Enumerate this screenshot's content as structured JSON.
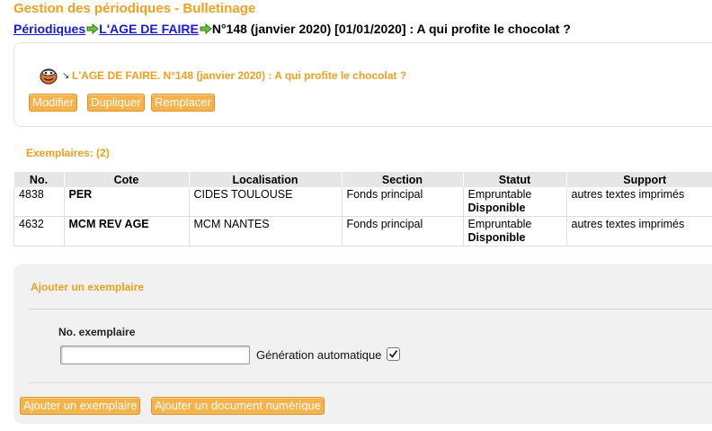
{
  "page": {
    "title": "Gestion des périodiques - Bulletinage"
  },
  "breadcrumb": {
    "items": [
      "Périodiques",
      "L'AGE DE FAIRE"
    ],
    "current": "N°148 (janvier 2020) [01/01/2020] : A qui profite le chocolat ?"
  },
  "record": {
    "title": "L'AGE DE FAIRE. N°148 (janvier 2020) : A qui profite le chocolat ?",
    "link_icon": "↘",
    "buttons": {
      "modify": "Modifier",
      "duplicate": "Dupliquer",
      "replace": "Remplacer"
    }
  },
  "copies": {
    "label": "Exemplaires: (2)",
    "columns": [
      "No.",
      "Cote",
      "Localisation",
      "Section",
      "Statut",
      "Support"
    ],
    "rows": [
      {
        "no": "4838",
        "cote": "PER",
        "localisation": "CIDES TOULOUSE",
        "section": "Fonds principal",
        "statut": "Empruntable",
        "statut2": "Disponible",
        "support": "autres textes imprimés"
      },
      {
        "no": "4632",
        "cote": "MCM REV AGE",
        "localisation": "MCM NANTES",
        "section": "Fonds principal",
        "statut": "Empruntable",
        "statut2": "Disponible",
        "support": "autres textes imprimés"
      }
    ]
  },
  "add": {
    "title": "Ajouter un exemplaire",
    "field_label": "No. exemplaire",
    "field_value": "",
    "auto_label": "Génération automatique",
    "auto_checked": true,
    "buttons": {
      "add_copy": "Ajouter un exemplaire",
      "add_digital": "Ajouter un document numérique"
    }
  },
  "colors": {
    "accent": "#f0a020",
    "link": "#1a18d8",
    "button_bg": "#f5b34a"
  },
  "icons": {
    "breadcrumb_separator": "arrow-right-icon",
    "record": "notice-icon",
    "record_link": "link-arrow-icon",
    "checkbox": "checkmark-icon"
  }
}
